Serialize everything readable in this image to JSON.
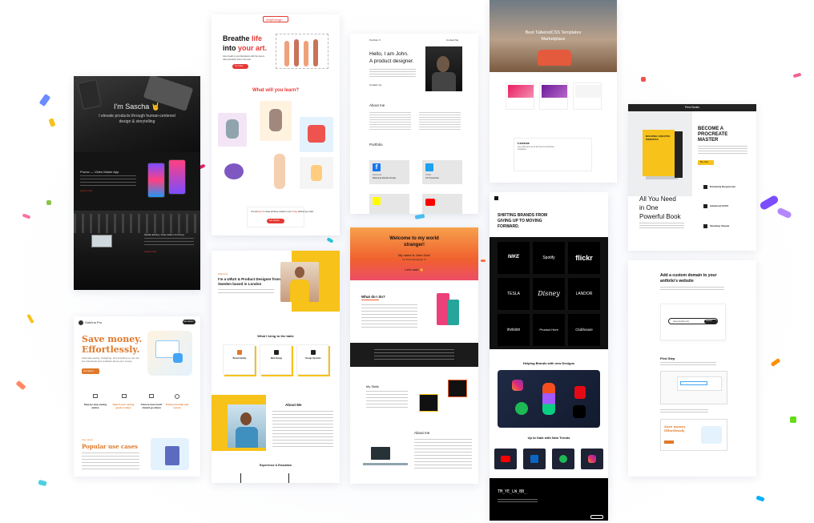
{
  "sascha": {
    "hero_title": "I'm Sascha 🤘",
    "hero_sub_1": "I elevate products through human-centered",
    "hero_sub_2": "design & storytelling",
    "project1_title": "Promo — Video Maker App",
    "project1_link": "Learn more",
    "project2_title": "Mobile Editing: Video Editor & Pricing",
    "project2_link": "Learn more"
  },
  "ahip": {
    "badge": "AhipDesign",
    "hero_line1a": "Breathe ",
    "hero_line1b": "life",
    "hero_line2a": "into ",
    "hero_line2b": "your art.",
    "hero_desc": "Give breath to your illustrations with the best-in-class animation tool on the web.",
    "hero_cta": "Try it free",
    "learn_title": "What will you learn?",
    "footer_text_a": "You will ",
    "footer_text_b": "learn",
    "footer_text_c": " to make all these models in one ",
    "footer_text_d": "Friday",
    "footer_text_e": " without any code!",
    "footer_cta": "Get started"
  },
  "john": {
    "nav_left": "Portfolio X",
    "nav_right": "Contact Me",
    "hero_1": "Hello, I am John.",
    "hero_2": "A product designer.",
    "hero_cta": "Contact me",
    "about_title": "About me",
    "portfolio_title": "Portfolio",
    "item1_name": "Facebook",
    "item1_desc": "Marketing Website Design",
    "item2_name": "Twitter",
    "item2_desc": "UX Transaction"
  },
  "world": {
    "title_1": "Welcome to my world",
    "title_2": "stranger!",
    "sub_1": "My name is John Doe!",
    "sub_2": "I'm Front Developer X!",
    "cta": "Let's start 👋",
    "do_title": "What do I do?",
    "skills_title": "My Skills",
    "about_title": "About me"
  },
  "tw": {
    "hero_1": "Best TailwindCSS Templates",
    "hero_2": "Marketplace",
    "license_title": "License",
    "license_sub": "Get unlimited use of all current and future templates"
  },
  "brands": {
    "headline_1": "SHIFTING BRANDS FROM",
    "headline_2": "GIVING UP TO MOVING",
    "headline_3": "FORWARD.",
    "logos": [
      "NIKE",
      "Spotify",
      "flickr",
      "TESLA",
      "Disney",
      "LANDOR",
      "invision",
      "Product Hunt",
      "Clubhouse"
    ],
    "helping_title": "Helping Brands with new Designs",
    "trends_title": "Up to Date with New Trends",
    "footer_handle": "TM_YE_LW_BB_"
  },
  "zeebook": {
    "nav_title": "Pera Books",
    "headline_1": "BECOME A",
    "headline_2": "PROCREATE",
    "headline_3": "MASTER",
    "cta": "Buy Now",
    "book_cover": "BUILDING CREATIVE WEBSITES",
    "feature1": "Extremely Responsive",
    "feature2": "Advanced Ui/UX",
    "feature3": "Stunning Visuals",
    "big_1": "All You Need",
    "big_2": "in One",
    "big_3": "Powerful Book"
  },
  "domain": {
    "title_1": "Add a custom domain to your",
    "title_2": "antfolio's website",
    "search_value": "www.yoursite.com",
    "search_cta": "Search",
    "first_step": "First Step",
    "save_title_1": "Save money",
    "save_title_2": "Effortlessly"
  },
  "savemoney": {
    "brand": "Sabrina Pro",
    "nav_cta": "Get started",
    "hero_1": "Save money.",
    "hero_2": "Effortlessly.",
    "hero_desc": "Automate saving, budgeting, and investing so you can live intentional and confident about your money",
    "hero_cta": "Get started",
    "features": [
      "Step by step saving advice",
      "Reach your saving goals in days",
      "Choose how much should go where",
      "Privacy friendly and secure"
    ],
    "popular_kicker": "Use cases",
    "popular_title": "Popular use cases"
  },
  "uxdesign": {
    "kicker": "Welcome",
    "hero_1": "I'm a UI/UX & Product Designer from",
    "hero_2": "Sweden based in London",
    "table_title": "What I bring to the table",
    "services": [
      "Brand Identity",
      "Web Design",
      "Design Systems"
    ],
    "about_title": "About Me",
    "exp_title": "Experience & Education"
  },
  "colors": {
    "orange": "#f08a24",
    "yellow": "#f7c21a",
    "red": "#e03a3a",
    "purple": "#8b5cf6",
    "dark": "#141414"
  }
}
